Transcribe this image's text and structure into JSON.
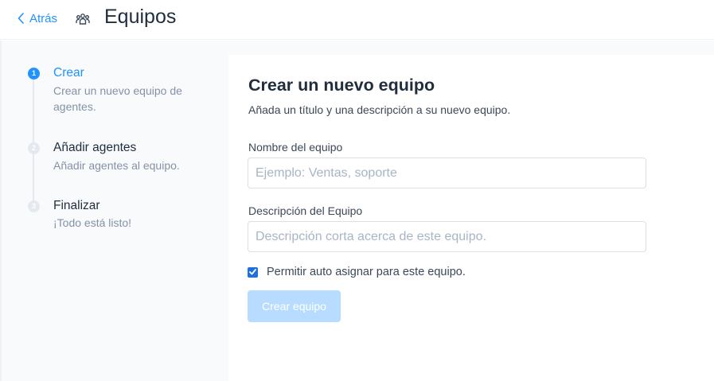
{
  "header": {
    "back_label": "Atrás",
    "title": "Equipos",
    "icons": {
      "back": "chevron-left-icon",
      "team": "people-group-icon"
    }
  },
  "steps": [
    {
      "number": "1",
      "title": "Crear",
      "description": "Crear un nuevo equipo de agentes.",
      "state": "active"
    },
    {
      "number": "2",
      "title": "Añadir agentes",
      "description": "Añadir agentes al equipo.",
      "state": "inactive"
    },
    {
      "number": "3",
      "title": "Finalizar",
      "description": "¡Todo está listo!",
      "state": "inactive"
    }
  ],
  "form": {
    "title": "Crear un nuevo equipo",
    "subtitle": "Añada un título y una descripción a su nuevo equipo.",
    "name_label": "Nombre del equipo",
    "name_placeholder": "Ejemplo: Ventas, soporte",
    "name_value": "",
    "description_label": "Descripción del Equipo",
    "description_placeholder": "Descripción corta acerca de este equipo.",
    "description_value": "",
    "auto_assign_label": "Permitir auto asignar para este equipo.",
    "auto_assign_checked": true,
    "submit_label": "Crear equipo"
  },
  "colors": {
    "accent": "#1f93ff",
    "button_disabled": "#b8dcff",
    "sidebar_bg": "#f8fafc"
  }
}
